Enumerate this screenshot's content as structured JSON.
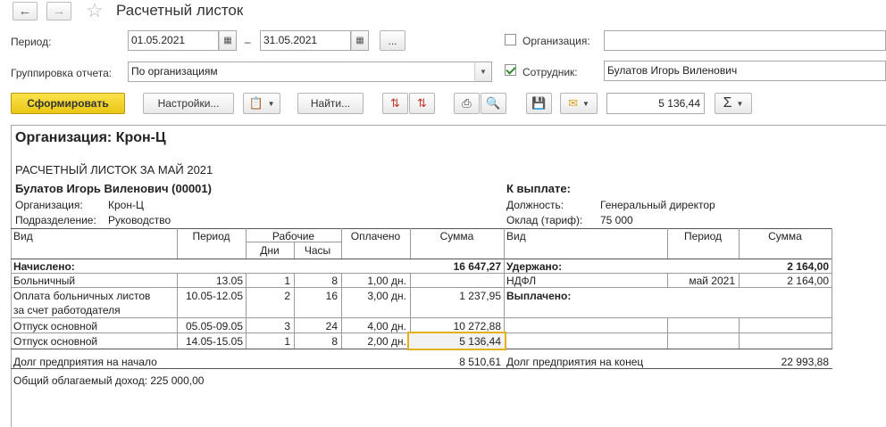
{
  "window": {
    "title": "Расчетный листок",
    "back_icon": "arrow-left-icon",
    "forward_icon": "arrow-right-icon",
    "favorite_icon": "star-icon"
  },
  "filters": {
    "period_label": "Период:",
    "period_from": "01.05.2021",
    "period_dash": "–",
    "period_to": "31.05.2021",
    "period_more": "...",
    "grouping_label": "Группировка отчета:",
    "grouping_value": "По организациям",
    "organization_label": "Организация:",
    "organization_checked": false,
    "organization_value": "",
    "employee_label": "Сотрудник:",
    "employee_checked": true,
    "employee_value": "Булатов Игорь Виленович"
  },
  "toolbar": {
    "generate_label": "Сформировать",
    "settings_label": "Настройки...",
    "find_label": "Найти...",
    "sum_value": "5 136,44",
    "sum_symbol": "Σ"
  },
  "report": {
    "org_heading": "Организация: Крон-Ц",
    "doc_title": "РАСЧЕТНЫЙ ЛИСТОК ЗА МАЙ 2021",
    "employee_name": "Булатов Игорь Виленович (00001)",
    "to_pay_label": "К выплате:",
    "info_left": [
      {
        "label": "Организация:",
        "value": "Крон-Ц"
      },
      {
        "label": "Подразделение:",
        "value": "Руководство"
      }
    ],
    "info_right": [
      {
        "label": "Должность:",
        "value": "Генеральный директор"
      },
      {
        "label": "Оклад (тариф):",
        "value": "75 000"
      }
    ],
    "headers": {
      "kind": "Вид",
      "period": "Период",
      "working": "Рабочие",
      "days": "Дни",
      "hours": "Часы",
      "paid": "Оплачено",
      "sum": "Сумма",
      "kind_r": "Вид",
      "period_r": "Период",
      "sum_r": "Сумма"
    },
    "accrued_label": "Начислено:",
    "accrued_total": "16 647,27",
    "withheld_label": "Удержано:",
    "withheld_total": "2 164,00",
    "paid_out_label": "Выплачено:",
    "accruals": [
      {
        "kind": "Больничный",
        "period": "13.05",
        "days": "1",
        "hours": "8",
        "paid": "1,00 дн.",
        "sum": ""
      },
      {
        "kind": "Оплата больничных листов",
        "kind2": "за счет работодателя",
        "period": "10.05-12.05",
        "days": "2",
        "hours": "16",
        "paid": "3,00 дн.",
        "sum": "1 237,95"
      },
      {
        "kind": "Отпуск основной",
        "period": "05.05-09.05",
        "days": "3",
        "hours": "24",
        "paid": "4,00 дн.",
        "sum": "10 272,88"
      },
      {
        "kind": "Отпуск основной",
        "period": "14.05-15.05",
        "days": "1",
        "hours": "8",
        "paid": "2,00 дн.",
        "sum": "5 136,44"
      }
    ],
    "withholdings": [
      {
        "kind": "НДФЛ",
        "period": "май 2021",
        "sum": "2 164,00"
      }
    ],
    "debt_start_label": "Долг предприятия на начало",
    "debt_start_value": "8 510,61",
    "debt_end_label": "Долг предприятия на конец",
    "debt_end_value": "22 993,88",
    "taxable_income": "Общий облагаемый доход: 225 000,00"
  }
}
